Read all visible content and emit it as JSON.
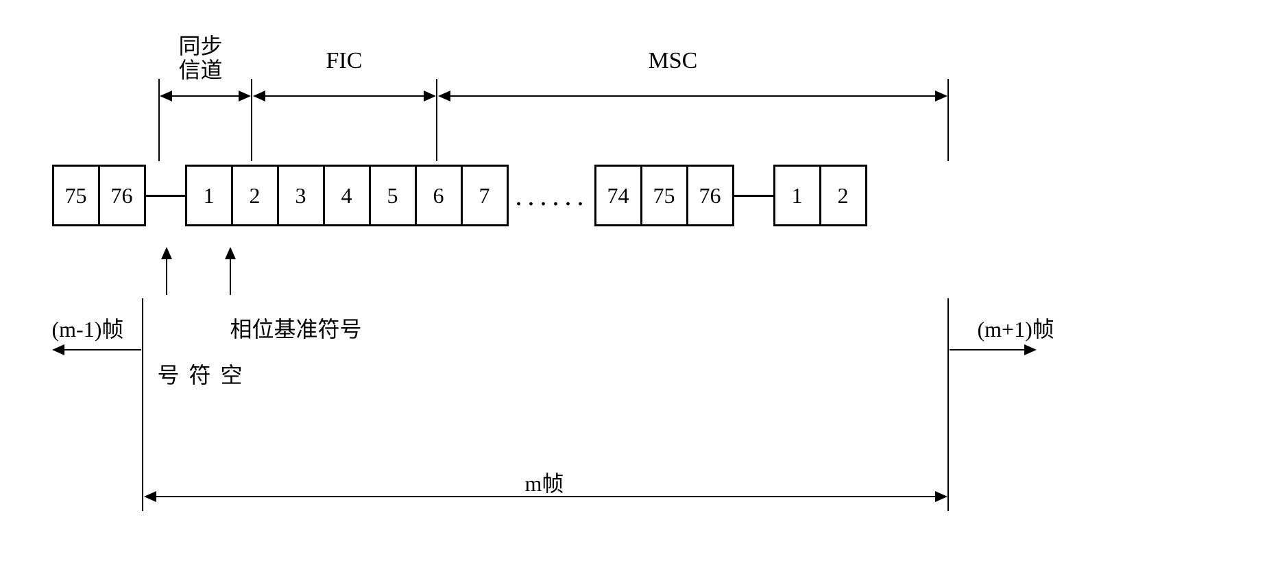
{
  "labels": {
    "sync_channel_line1": "同步",
    "sync_channel_line2": "信道",
    "fic": "FIC",
    "msc": "MSC"
  },
  "boxes": {
    "prev": [
      "75",
      "76"
    ],
    "main_left": [
      "1",
      "2",
      "3",
      "4",
      "5",
      "6",
      "7"
    ],
    "main_right": [
      "74",
      "75",
      "76"
    ],
    "next": [
      "1",
      "2"
    ]
  },
  "dots": "......",
  "annotations": {
    "null_symbol": "空符号",
    "phase_ref": "相位基准符号",
    "prev_frame": "(m-1)帧",
    "next_frame": "(m+1)帧",
    "current_frame": "m帧"
  }
}
